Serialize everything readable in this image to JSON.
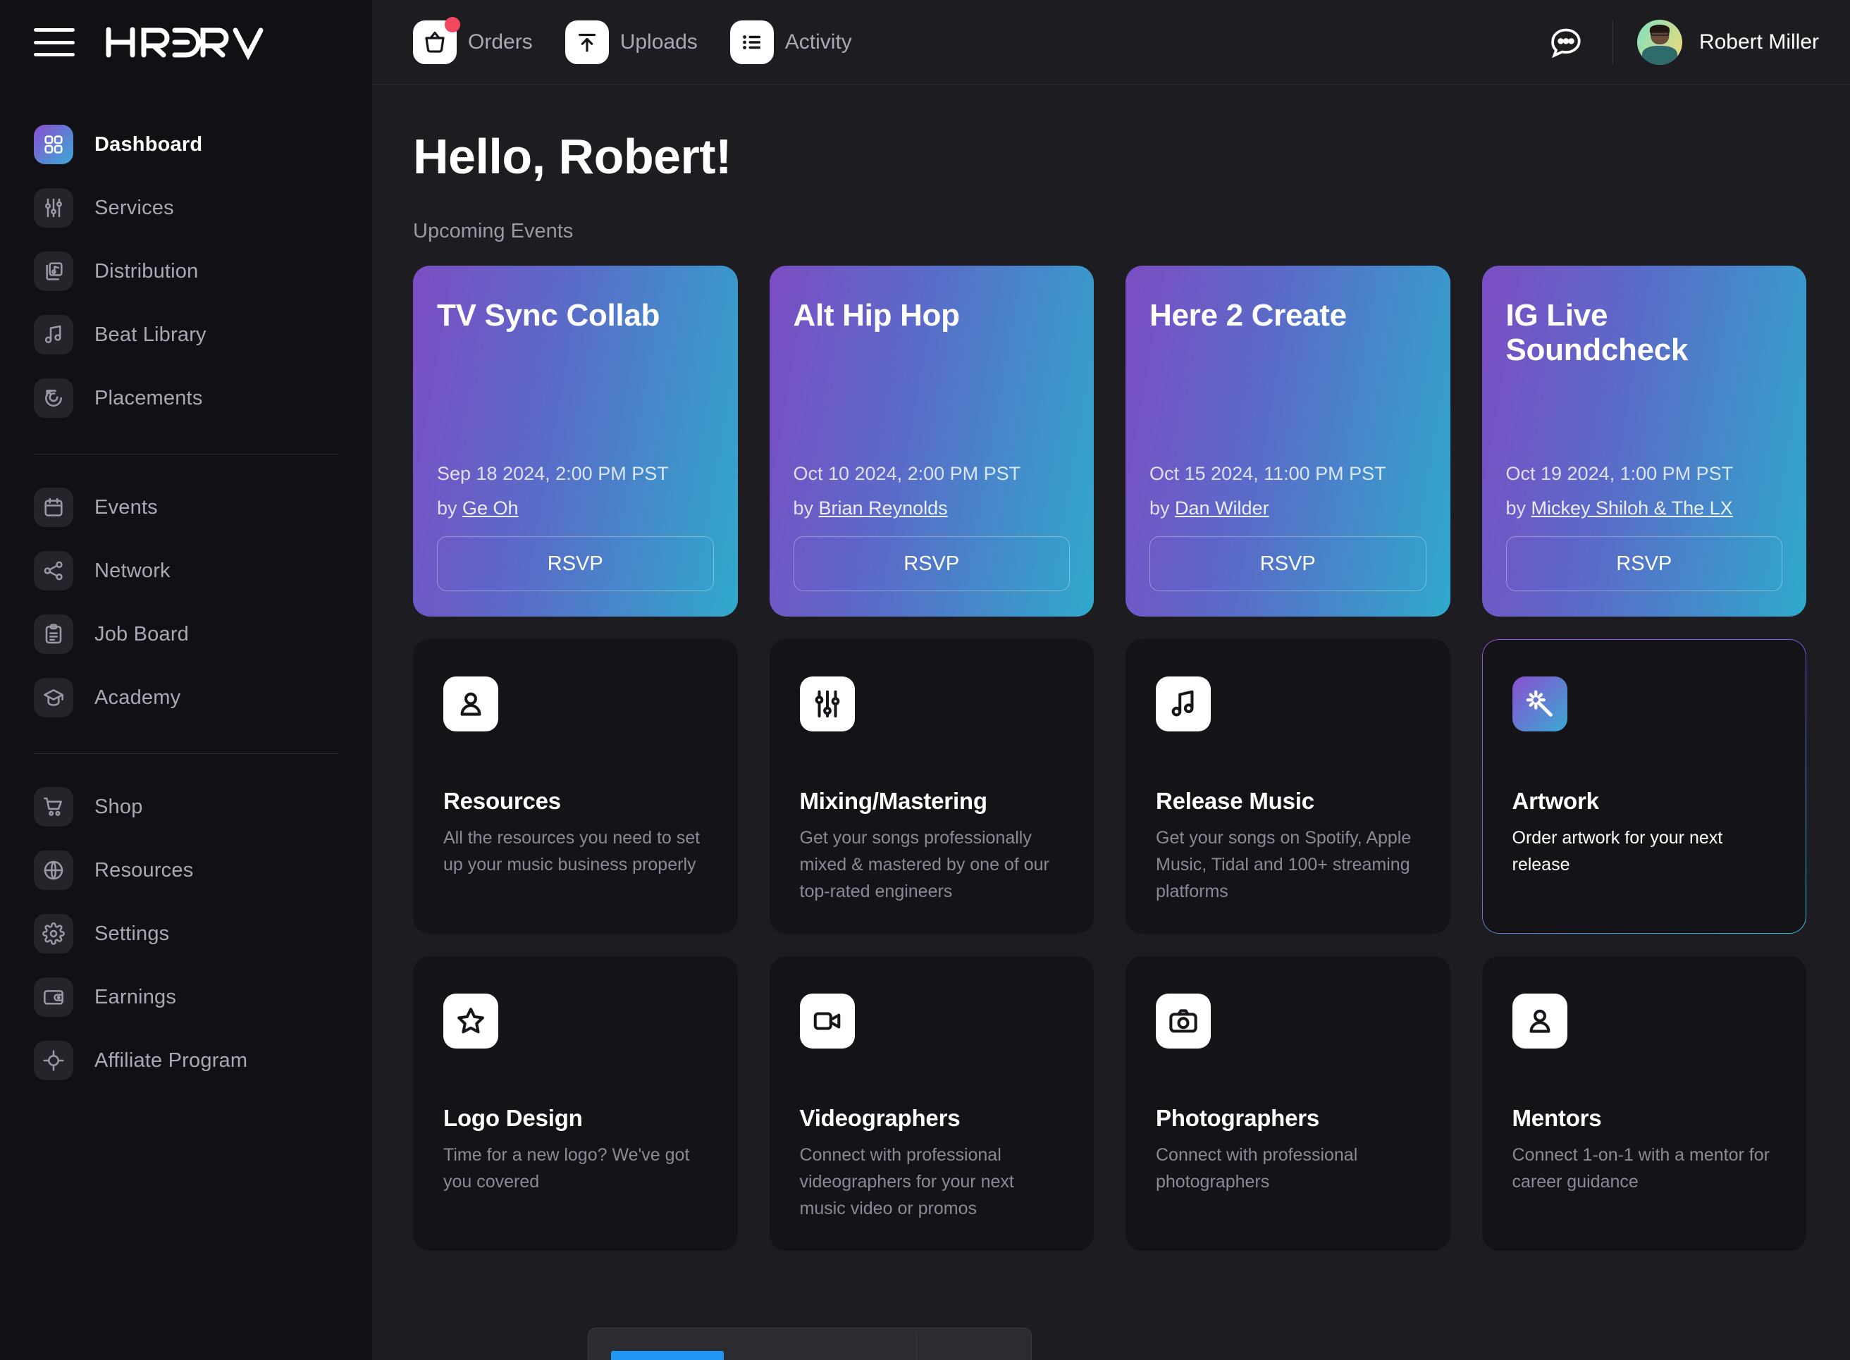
{
  "brand": {
    "logo_text": "HRDRV"
  },
  "header": {
    "nav": [
      {
        "label": "Orders",
        "icon": "orders-basket-icon",
        "badge": true
      },
      {
        "label": "Uploads",
        "icon": "upload-icon",
        "badge": false
      },
      {
        "label": "Activity",
        "icon": "list-icon",
        "badge": false
      }
    ],
    "chat_icon": "chat-bubble-icon",
    "user_name": "Robert Miller"
  },
  "sidebar": {
    "groups": [
      {
        "items": [
          {
            "label": "Dashboard",
            "icon": "grid-icon",
            "active": true
          },
          {
            "label": "Services",
            "icon": "sliders-icon",
            "active": false
          },
          {
            "label": "Distribution",
            "icon": "album-music-icon",
            "active": false
          },
          {
            "label": "Beat Library",
            "icon": "music-note-icon",
            "active": false
          },
          {
            "label": "Placements",
            "icon": "target-arrow-icon",
            "active": false
          }
        ]
      },
      {
        "items": [
          {
            "label": "Events",
            "icon": "calendar-icon",
            "active": false
          },
          {
            "label": "Network",
            "icon": "share-nodes-icon",
            "active": false
          },
          {
            "label": "Job Board",
            "icon": "clipboard-icon",
            "active": false
          },
          {
            "label": "Academy",
            "icon": "graduation-cap-icon",
            "active": false
          }
        ]
      },
      {
        "items": [
          {
            "label": "Shop",
            "icon": "shopping-cart-icon",
            "active": false
          },
          {
            "label": "Resources",
            "icon": "globe-icon",
            "active": false
          },
          {
            "label": "Settings",
            "icon": "gear-icon",
            "active": false
          },
          {
            "label": "Earnings",
            "icon": "wallet-icon",
            "active": false
          },
          {
            "label": "Affiliate Program",
            "icon": "crosshair-icon",
            "active": false
          }
        ]
      }
    ]
  },
  "main": {
    "greeting": "Hello, Robert!",
    "section_label": "Upcoming Events",
    "rsvp_label": "RSVP",
    "by_prefix": "by ",
    "events": [
      {
        "title": "TV Sync Collab",
        "date": "Sep 18 2024, 2:00 PM PST",
        "host": "Ge Oh"
      },
      {
        "title": "Alt Hip Hop",
        "date": "Oct 10 2024, 2:00 PM PST",
        "host": "Brian Reynolds"
      },
      {
        "title": "Here 2 Create",
        "date": "Oct 15 2024, 11:00 PM PST",
        "host": "Dan Wilder"
      },
      {
        "title": "IG Live Soundcheck",
        "date": "Oct 19 2024, 1:00 PM PST",
        "host": "Mickey Shiloh & The LX"
      }
    ],
    "services": [
      {
        "title": "Resources",
        "desc": "All the resources you need to set up your music business properly",
        "icon": "person-card-icon",
        "highlighted": false
      },
      {
        "title": "Mixing/Mastering",
        "desc": "Get your songs professionally mixed & mastered by one of our top-rated engineers",
        "icon": "sliders-icon",
        "highlighted": false
      },
      {
        "title": "Release Music",
        "desc": "Get your songs on Spotify, Apple Music, Tidal and 100+ streaming platforms",
        "icon": "music-note-icon",
        "highlighted": false
      },
      {
        "title": "Artwork",
        "desc": "Order artwork for your next release",
        "icon": "magic-wand-icon",
        "highlighted": true
      },
      {
        "title": "Logo Design",
        "desc": "Time for a new logo? We've got you covered",
        "icon": "star-icon",
        "highlighted": false
      },
      {
        "title": "Videographers",
        "desc": "Connect with professional videographers for your next music video or promos",
        "icon": "video-camera-icon",
        "highlighted": false
      },
      {
        "title": "Photographers",
        "desc": "Connect with professional photographers",
        "icon": "camera-icon",
        "highlighted": false
      },
      {
        "title": "Mentors",
        "desc": "Connect 1-on-1 with a mentor for career guidance",
        "icon": "person-card-icon",
        "highlighted": false
      }
    ]
  },
  "colors": {
    "accent_start": "#7c4dc4",
    "accent_end": "#2fa9cc",
    "badge": "#f2485f",
    "page_bg": "#1c1c21",
    "sidebar_bg": "#111115",
    "card_bg": "#141418"
  }
}
